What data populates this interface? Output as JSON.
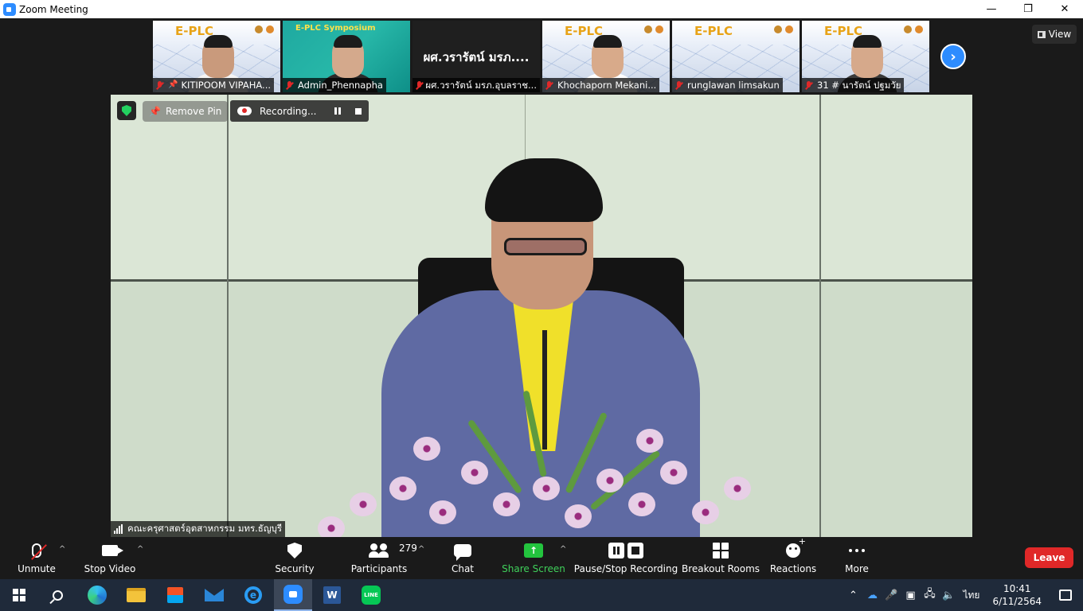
{
  "window": {
    "title": "Zoom Meeting",
    "minimize": "—",
    "maximize": "❐",
    "close": "✕"
  },
  "view_button": {
    "label": "View"
  },
  "thumbnails": [
    {
      "name": "KITIPOOM VIPAHA...",
      "muted": true,
      "pinned": true,
      "logo": "E-PLC"
    },
    {
      "name": "Admin_Phennapha",
      "muted": true,
      "logo": "E-PLC Symposium"
    },
    {
      "name": "ผศ.วรารัตน์ มรภ.อุบลราช...",
      "muted": true,
      "big_label": "ผศ.วรารัตน์ มรภ...."
    },
    {
      "name": "Khochaporn Mekani...",
      "muted": true,
      "logo": "E-PLC"
    },
    {
      "name": "runglawan limsakun",
      "muted": true,
      "logo": "E-PLC"
    },
    {
      "name": "31 # นารัตน์ ปฐมวัย",
      "muted": true,
      "logo": "E-PLC"
    }
  ],
  "main_video": {
    "remove_pin_label": "Remove Pin",
    "recording_label": "Recording...",
    "speaker_name": "คณะครุศาสตร์อุตสาหกรรม มทร.ธัญบุรี"
  },
  "toolbar": {
    "unmute": "Unmute",
    "stop_video": "Stop Video",
    "security": "Security",
    "participants": "Participants",
    "participants_count": "279",
    "chat": "Chat",
    "share_screen": "Share Screen",
    "pause_stop_recording": "Pause/Stop Recording",
    "breakout_rooms": "Breakout Rooms",
    "reactions": "Reactions",
    "more": "More",
    "leave": "Leave"
  },
  "taskbar": {
    "language": "ไทย",
    "time": "10:41",
    "date": "6/11/2564"
  },
  "colors": {
    "accent": "#2d8cff",
    "leave": "#e02828",
    "share": "#23c43e",
    "security_ok": "#23d160"
  }
}
